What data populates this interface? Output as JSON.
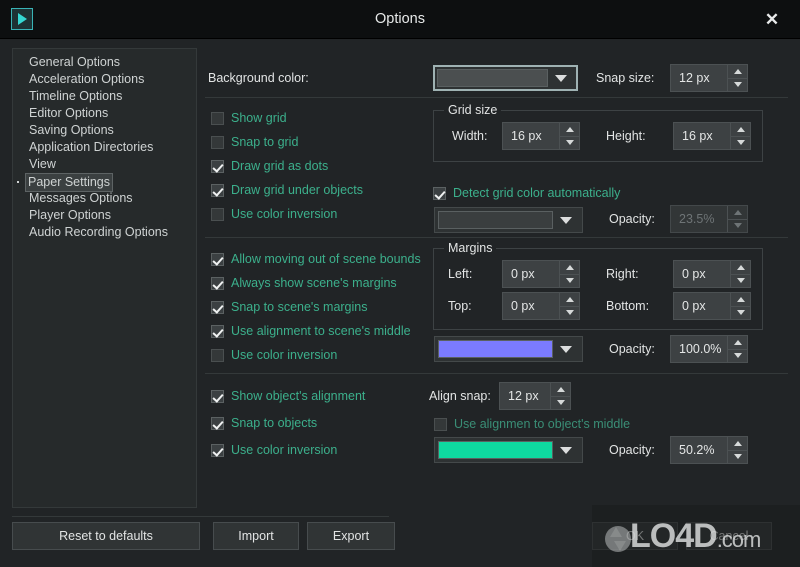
{
  "window": {
    "title": "Options",
    "app_icon": "play-triangle-icon",
    "close_label": "✕"
  },
  "sidebar": {
    "items": [
      {
        "label": "General Options",
        "selected": false
      },
      {
        "label": "Acceleration Options",
        "selected": false
      },
      {
        "label": "Timeline Options",
        "selected": false
      },
      {
        "label": "Editor Options",
        "selected": false
      },
      {
        "label": "Saving Options",
        "selected": false
      },
      {
        "label": "Application Directories",
        "selected": false
      },
      {
        "label": "View",
        "selected": false
      },
      {
        "label": "Paper Settings",
        "selected": true
      },
      {
        "label": "Messages Options",
        "selected": false
      },
      {
        "label": "Player Options",
        "selected": false
      },
      {
        "label": "Audio Recording Options",
        "selected": false
      }
    ]
  },
  "main": {
    "background_color_label": "Background color:",
    "background_color_swatch": "#4b4f50",
    "snap_size_label": "Snap size:",
    "snap_size_value": "12 px",
    "grid_group_title": "Grid size",
    "grid_width_label": "Width:",
    "grid_width_value": "16 px",
    "grid_height_label": "Height:",
    "grid_height_value": "16 px",
    "grid_checks": [
      {
        "label": "Show grid",
        "checked": false
      },
      {
        "label": "Snap to grid",
        "checked": false
      },
      {
        "label": "Draw grid as dots",
        "checked": true
      },
      {
        "label": "Draw grid under objects",
        "checked": true
      },
      {
        "label": "Use color inversion",
        "checked": false
      }
    ],
    "detect_grid_label": "Detect grid color automatically",
    "detect_grid_checked": true,
    "grid_color_swatch": "#3a3e3f",
    "grid_opacity_label": "Opacity:",
    "grid_opacity_value": "23.5%",
    "grid_opacity_disabled": true,
    "scene_checks": [
      {
        "label": "Allow moving out of scene bounds",
        "checked": true
      },
      {
        "label": "Always show scene's margins",
        "checked": true
      },
      {
        "label": "Snap to scene's margins",
        "checked": true
      },
      {
        "label": "Use alignment to scene's middle",
        "checked": true
      },
      {
        "label": "Use color inversion",
        "checked": false
      }
    ],
    "margins_group_title": "Margins",
    "margin_left_label": "Left:",
    "margin_left_value": "0 px",
    "margin_right_label": "Right:",
    "margin_right_value": "0 px",
    "margin_top_label": "Top:",
    "margin_top_value": "0 px",
    "margin_bottom_label": "Bottom:",
    "margin_bottom_value": "0 px",
    "scene_color_swatch": "#7b7bff",
    "scene_opacity_label": "Opacity:",
    "scene_opacity_value": "100.0%",
    "object_checks": [
      {
        "label": "Show object's alignment",
        "checked": true
      },
      {
        "label": "Snap to objects",
        "checked": true
      },
      {
        "label": "Use color inversion",
        "checked": true
      }
    ],
    "align_snap_label": "Align snap:",
    "align_snap_value": "12 px",
    "align_middle_label": "Use alignmen to object's middle",
    "align_middle_checked": false,
    "object_color_swatch": "#0fd9a0",
    "object_opacity_label": "Opacity:",
    "object_opacity_value": "50.2%"
  },
  "footer": {
    "reset_label": "Reset to defaults",
    "import_label": "Import",
    "export_label": "Export",
    "ok_label": "OK",
    "cancel_label": "Cancel"
  },
  "watermark": {
    "text": "LO4D",
    "suffix": ".com"
  }
}
